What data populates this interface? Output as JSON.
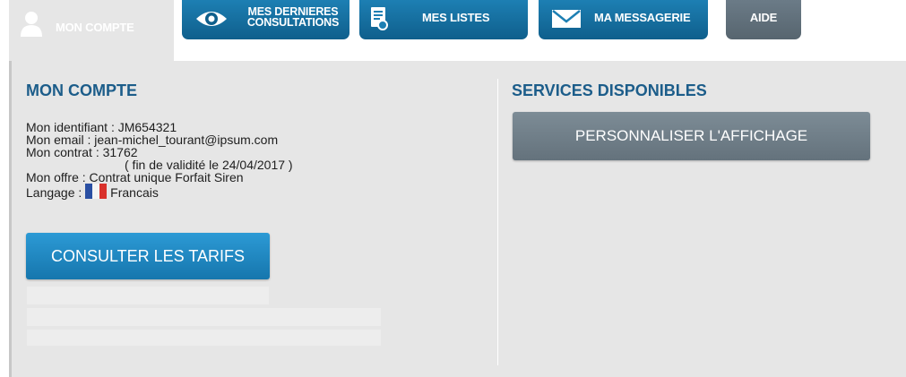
{
  "tabs": {
    "account": {
      "label": "MON COMPTE",
      "icon": "user-icon"
    },
    "consultations": {
      "label": "MES DERNIERES\nCONSULTATIONS",
      "icon": "eye-icon"
    },
    "lists": {
      "label": "MES LISTES",
      "icon": "document-icon"
    },
    "messages": {
      "label": "MA MESSAGERIE",
      "icon": "envelope-icon"
    },
    "help": {
      "label": "AIDE"
    }
  },
  "account": {
    "title": "MON COMPTE",
    "identifier": "Mon identifiant : JM654321",
    "email": "Mon email : jean-michel_tourant@ipsum.com",
    "contract": "Mon contrat : 31762",
    "validity": "( fin de validité le 24/04/2017 )",
    "offer": "Mon offre : Contrat unique Forfait Siren",
    "language_label": "Langage : ",
    "language_value": "Francais",
    "language_flag": "french-flag-icon",
    "consult_button": "CONSULTER LES TARIFS"
  },
  "services": {
    "title": "SERVICES DISPONIBLES",
    "customize_button": "PERSONNALISER L'AFFICHAGE"
  },
  "colors": {
    "tab_blue": "#1d7fb3",
    "tab_grey": "#5f6d78",
    "title_blue": "#1c5d8a",
    "panel_bg": "#e6e6e6"
  }
}
